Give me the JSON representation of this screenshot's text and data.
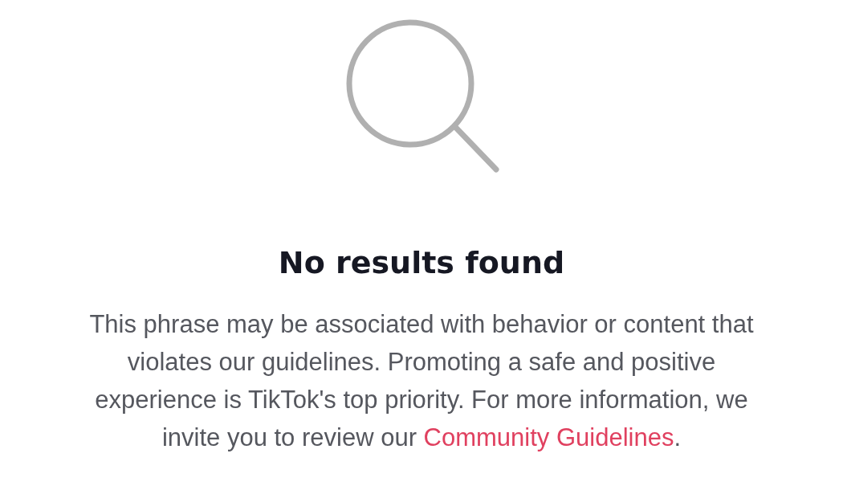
{
  "empty_state": {
    "title": "No results found",
    "message": "This phrase may be associated with behavior or content that violates our guidelines. Promoting a safe and positive experience is TikTok's top priority. For more information, we invite you to review our ",
    "link": "Community Guidelines",
    "message_end": "."
  }
}
